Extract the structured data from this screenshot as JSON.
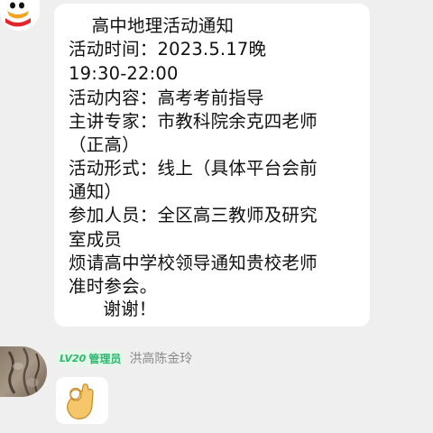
{
  "message": {
    "lines": [
      "    高中地理活动通知",
      "活动时间：2023.5.17晚",
      "19:30-22:00",
      "活动内容：高考考前指导",
      "主讲专家：市教科院余克四老师",
      "（正高）",
      "活动形式：线上（具体平台会前",
      "通知）",
      "参加人员：全区高三教师及研究",
      "室成员",
      "烦请高中学校领导通知贵校老师",
      "准时参会。",
      "      谢谢！"
    ]
  },
  "sender": {
    "level": "LV20",
    "role": "管理员",
    "name": "洪高陈金玲"
  },
  "reply": {
    "emoji": "ok-hand-emoji"
  },
  "colors": {
    "background": "#efefef",
    "bubble": "#ffffff",
    "badge_text": "#2eb872",
    "badge_bg": "#e4f7e9",
    "name_text": "#8a8a8a"
  }
}
